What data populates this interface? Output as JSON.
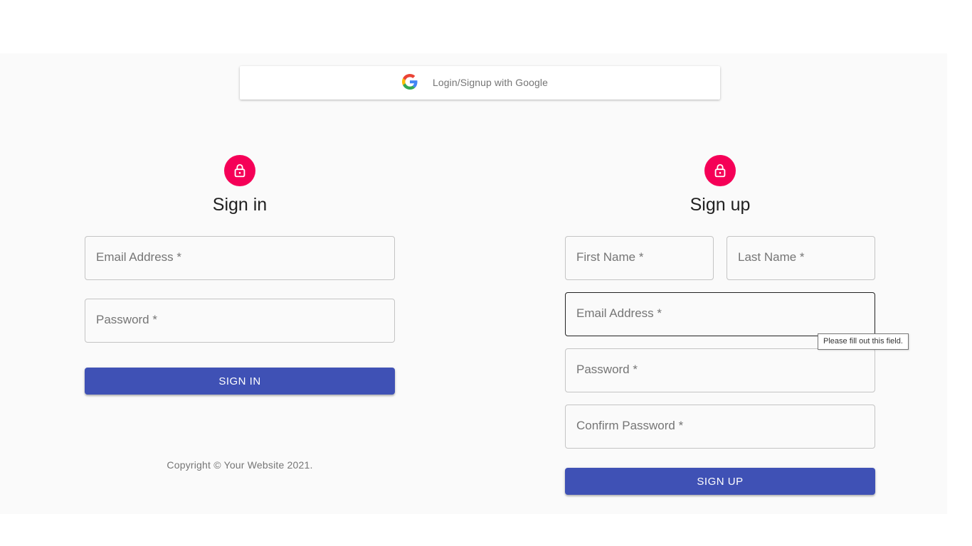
{
  "google": {
    "label": "Login/Signup with Google",
    "icon": "google-g-icon"
  },
  "signin": {
    "icon": "lock-icon",
    "title": "Sign in",
    "email_placeholder": "Email Address *",
    "password_placeholder": "Password *",
    "submit_label": "SIGN IN"
  },
  "signup": {
    "icon": "lock-icon",
    "title": "Sign up",
    "first_name_placeholder": "First Name *",
    "last_name_placeholder": "Last Name *",
    "email_placeholder": "Email Address *",
    "password_placeholder": "Password *",
    "confirm_password_placeholder": "Confirm Password *",
    "submit_label": "SIGN UP"
  },
  "validation_tooltip": "Please fill out this field.",
  "footer": {
    "copyright": "Copyright © Your Website 2021."
  },
  "colors": {
    "primary": "#3f51b5",
    "secondary": "#f50057",
    "background": "#fafafa"
  }
}
